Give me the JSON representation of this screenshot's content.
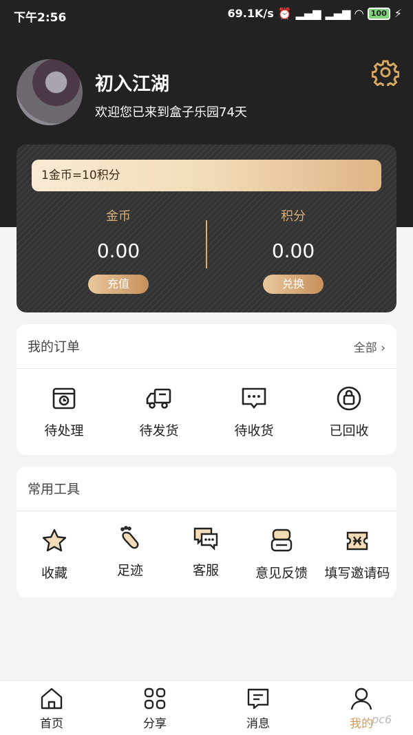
{
  "status_bar": {
    "time": "下午2:56",
    "speed": "69.1K/s",
    "battery": "100"
  },
  "profile": {
    "name": "初入江湖",
    "welcome": "欢迎您已来到盒子乐园74天"
  },
  "wallet": {
    "rate": "1金币=10积分",
    "coins_label": "金币",
    "coins_value": "0.00",
    "coins_button": "充值",
    "points_label": "积分",
    "points_value": "0.00",
    "points_button": "兑换"
  },
  "orders": {
    "title": "我的订单",
    "all_label": "全部 ›",
    "items": [
      {
        "label": "待处理",
        "icon": "pending-icon"
      },
      {
        "label": "待发货",
        "icon": "truck-icon"
      },
      {
        "label": "待收货",
        "icon": "message-icon"
      },
      {
        "label": "已回收",
        "icon": "recycled-bag-icon"
      }
    ]
  },
  "tools": {
    "title": "常用工具",
    "items": [
      {
        "label": "收藏",
        "icon": "star-icon"
      },
      {
        "label": "足迹",
        "icon": "footprint-icon"
      },
      {
        "label": "客服",
        "icon": "customer-service-icon"
      },
      {
        "label": "意见反馈",
        "icon": "feedback-icon"
      },
      {
        "label": "填写邀请码",
        "icon": "invite-code-icon"
      }
    ]
  },
  "tabbar": {
    "items": [
      {
        "label": "首页",
        "icon": "home-icon"
      },
      {
        "label": "分享",
        "icon": "grid-icon"
      },
      {
        "label": "消息",
        "icon": "chat-icon"
      },
      {
        "label": "我的",
        "icon": "user-icon",
        "active": true
      }
    ]
  },
  "watermark": "pc6",
  "colors": {
    "gold": "#d39b58",
    "dark": "#222222"
  }
}
